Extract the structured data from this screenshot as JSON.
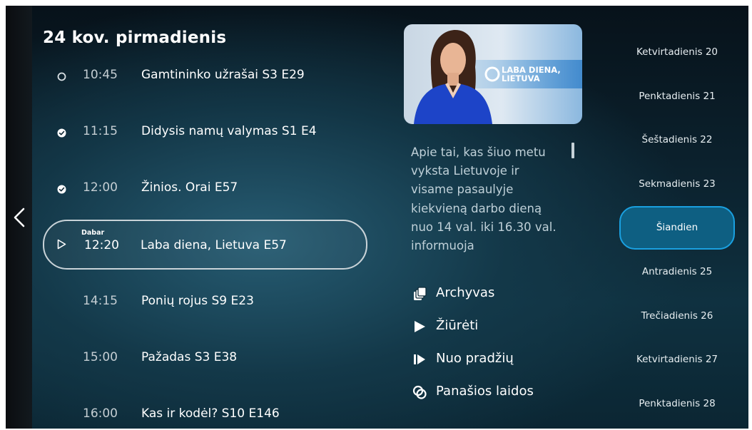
{
  "header": {
    "date_title": "24 kov. pirmadienis"
  },
  "program_list": [
    {
      "time": "10:45",
      "title": "Gamtininko užrašai S3 E29",
      "status": "not-watched"
    },
    {
      "time": "11:15",
      "title": "Didysis namų valymas S1 E4",
      "status": "watched"
    },
    {
      "time": "12:00",
      "title": "Žinios. Orai E57",
      "status": "watched"
    },
    {
      "time": "12:20",
      "title": "Laba diena, Lietuva E57",
      "status": "now",
      "now_label": "Dabar"
    },
    {
      "time": "14:15",
      "title": "Ponių rojus S9 E23",
      "status": "future"
    },
    {
      "time": "15:00",
      "title": "Pažadas S3 E38",
      "status": "future"
    },
    {
      "time": "16:00",
      "title": "Kas ir kodėl? S10 E146",
      "status": "future"
    }
  ],
  "detail": {
    "thumbnail_logo_text": "LABA DIENA, LIETUVA",
    "description": "Apie tai, kas šiuo metu vyksta Lietuvoje ir visame pasaulyje kiekvieną darbo dieną nuo 14 val. iki 16.30 val. informuoja"
  },
  "actions": [
    {
      "label": "Archyvas",
      "icon": "archive-icon"
    },
    {
      "label": "Žiūrėti",
      "icon": "play-icon"
    },
    {
      "label": "Nuo pradžių",
      "icon": "play-from-start-icon"
    },
    {
      "label": "Panašios laidos",
      "icon": "similar-shows-icon"
    }
  ],
  "days": [
    {
      "label": "Ketvirtadienis 20"
    },
    {
      "label": "Penktadienis 21"
    },
    {
      "label": "Šeštadienis 22"
    },
    {
      "label": "Sekmadienis 23"
    },
    {
      "label": "Šiandien",
      "selected": true
    },
    {
      "label": "Antradienis 25"
    },
    {
      "label": "Trečiadienis 26"
    },
    {
      "label": "Ketvirtadienis 27"
    },
    {
      "label": "Penktadienis 28"
    }
  ],
  "colors": {
    "accent_blue": "#1aa0e0",
    "selected_day_fill": "#0e5f82",
    "text_primary": "#ffffff",
    "text_secondary": "#c5ced3"
  }
}
